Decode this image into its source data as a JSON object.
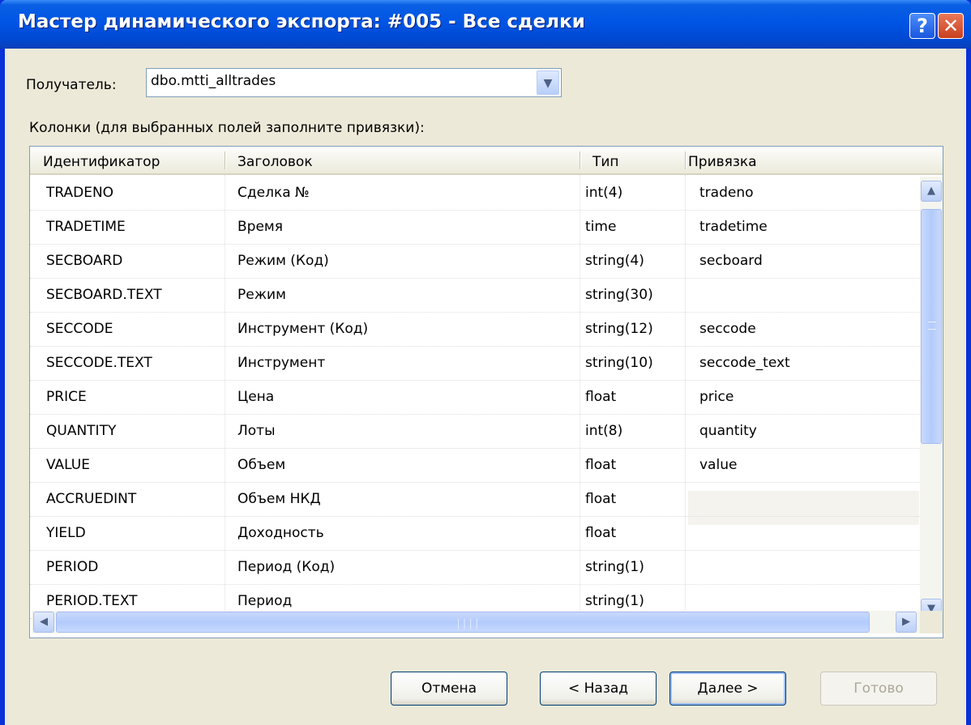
{
  "window": {
    "title": "Мастер динамического экспорта: #005 - Все сделки",
    "help_label": "?",
    "close_label": "✕"
  },
  "recipient": {
    "label": "Получатель:",
    "value": "dbo.mtti_alltrades"
  },
  "columns_label": "Колонки (для выбранных полей заполните привязки):",
  "table": {
    "headers": [
      "Идентификатор",
      "Заголовок",
      "Тип",
      "Привязка"
    ],
    "rows": [
      [
        "TRADENO",
        "Сделка №",
        "int(4)",
        "tradeno"
      ],
      [
        "TRADETIME",
        "Время",
        "time",
        "tradetime"
      ],
      [
        "SECBOARD",
        "Режим (Код)",
        "string(4)",
        "secboard"
      ],
      [
        "SECBOARD.TEXT",
        "Режим",
        "string(30)",
        ""
      ],
      [
        "SECCODE",
        "Инструмент (Код)",
        "string(12)",
        "seccode"
      ],
      [
        "SECCODE.TEXT",
        "Инструмент",
        "string(10)",
        "seccode_text"
      ],
      [
        "PRICE",
        "Цена",
        "float",
        "price"
      ],
      [
        "QUANTITY",
        "Лоты",
        "int(8)",
        "quantity"
      ],
      [
        "VALUE",
        "Объем",
        "float",
        "value"
      ],
      [
        "ACCRUEDINT",
        "Объем НКД",
        "float",
        ""
      ],
      [
        "YIELD",
        "Доходность",
        "float",
        ""
      ],
      [
        "PERIOD",
        "Период (Код)",
        "string(1)",
        ""
      ],
      [
        "PERIOD.TEXT",
        "Период",
        "string(1)",
        ""
      ]
    ]
  },
  "buttons": {
    "cancel": "Отмена",
    "back": "< Назад",
    "next": "Далее >",
    "finish": "Готово"
  },
  "colors": {
    "titlebar": "#0055e5",
    "dialog_bg": "#ece9d8",
    "disabled_text": "#aca899"
  }
}
